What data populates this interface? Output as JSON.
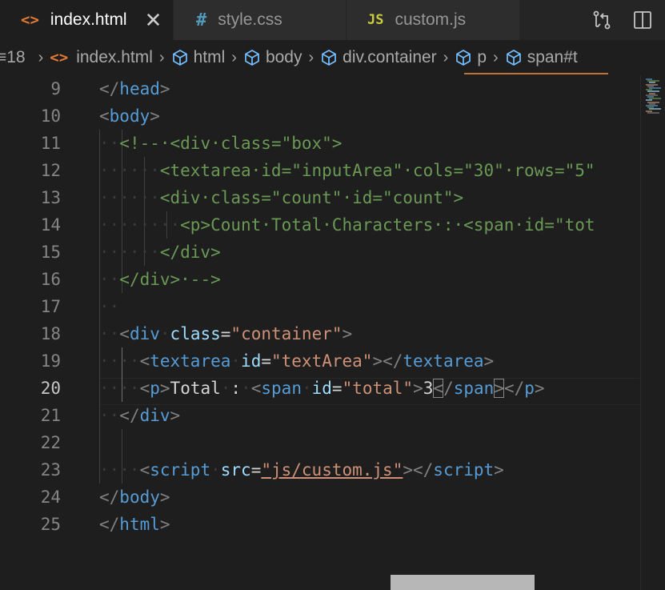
{
  "tabs": [
    {
      "label": "index.html",
      "icon": "<>",
      "active": true,
      "close": "✕"
    },
    {
      "label": "style.css",
      "icon": "#",
      "active": false
    },
    {
      "label": "custom.js",
      "icon": "JS",
      "active": false
    }
  ],
  "breadcrumb": {
    "lead": "≡18",
    "file": "index.html",
    "file_icon": "<>",
    "items": [
      "html",
      "body",
      "div.container",
      "p",
      "span#t"
    ]
  },
  "editor": {
    "active_line": 20,
    "line_numbers": [
      "9",
      "10",
      "11",
      "12",
      "13",
      "14",
      "15",
      "16",
      "17",
      "18",
      "19",
      "20",
      "21",
      "22",
      "23",
      "24",
      "25"
    ],
    "lines": [
      {
        "tokens": [
          {
            "k": "p",
            "v": "</"
          },
          {
            "k": "t",
            "v": "head"
          },
          {
            "k": "p",
            "v": ">"
          }
        ]
      },
      {
        "tokens": [
          {
            "k": "p",
            "v": "<"
          },
          {
            "k": "t",
            "v": "body"
          },
          {
            "k": "p",
            "v": ">"
          }
        ]
      },
      {
        "tokens": [
          {
            "k": "dot",
            "v": "··"
          },
          {
            "k": "c",
            "v": "<!--·<div·class=\"box\">"
          }
        ]
      },
      {
        "tokens": [
          {
            "k": "dot",
            "v": "······"
          },
          {
            "k": "c",
            "v": "<textarea·id=\"inputArea\"·cols=\"30\"·rows=\"5\""
          }
        ]
      },
      {
        "tokens": [
          {
            "k": "dot",
            "v": "······"
          },
          {
            "k": "c",
            "v": "<div·class=\"count\"·id=\"count\">"
          }
        ]
      },
      {
        "tokens": [
          {
            "k": "dot",
            "v": "········"
          },
          {
            "k": "c",
            "v": "<p>Count·Total·Characters·:·<span·id=\"tot"
          }
        ]
      },
      {
        "tokens": [
          {
            "k": "dot",
            "v": "······"
          },
          {
            "k": "c",
            "v": "</div>"
          }
        ]
      },
      {
        "tokens": [
          {
            "k": "dot",
            "v": "··"
          },
          {
            "k": "c",
            "v": "</div>·-->"
          }
        ]
      },
      {
        "tokens": [
          {
            "k": "dot",
            "v": "··"
          }
        ]
      },
      {
        "tokens": [
          {
            "k": "dot",
            "v": "··"
          },
          {
            "k": "p",
            "v": "<"
          },
          {
            "k": "t",
            "v": "div"
          },
          {
            "k": "dot",
            "v": "·"
          },
          {
            "k": "a",
            "v": "class"
          },
          {
            "k": "x",
            "v": "="
          },
          {
            "k": "s",
            "v": "\"container\""
          },
          {
            "k": "p",
            "v": ">"
          }
        ]
      },
      {
        "tokens": [
          {
            "k": "dot",
            "v": "····"
          },
          {
            "k": "p",
            "v": "<"
          },
          {
            "k": "t",
            "v": "textarea"
          },
          {
            "k": "dot",
            "v": "·"
          },
          {
            "k": "a",
            "v": "id"
          },
          {
            "k": "x",
            "v": "="
          },
          {
            "k": "s",
            "v": "\"textArea\""
          },
          {
            "k": "p",
            "v": "></"
          },
          {
            "k": "t",
            "v": "textarea"
          },
          {
            "k": "p",
            "v": ">"
          }
        ]
      },
      {
        "tokens": [
          {
            "k": "dot",
            "v": "····"
          },
          {
            "k": "p",
            "v": "<"
          },
          {
            "k": "t",
            "v": "p"
          },
          {
            "k": "p",
            "v": ">"
          },
          {
            "k": "x",
            "v": "Total"
          },
          {
            "k": "dot",
            "v": "·"
          },
          {
            "k": "x",
            "v": ":"
          },
          {
            "k": "dot",
            "v": "·"
          },
          {
            "k": "p",
            "v": "<"
          },
          {
            "k": "t",
            "v": "span"
          },
          {
            "k": "dot",
            "v": "·"
          },
          {
            "k": "a",
            "v": "id"
          },
          {
            "k": "x",
            "v": "="
          },
          {
            "k": "s",
            "v": "\"total\""
          },
          {
            "k": "p",
            "v": ">"
          },
          {
            "k": "x",
            "v": "3"
          },
          {
            "k": "p bm",
            "v": "<"
          },
          {
            "k": "p",
            "v": "/"
          },
          {
            "k": "t",
            "v": "span"
          },
          {
            "k": "p bm",
            "v": ">"
          },
          {
            "k": "p",
            "v": "</"
          },
          {
            "k": "t",
            "v": "p"
          },
          {
            "k": "p",
            "v": ">"
          }
        ]
      },
      {
        "tokens": [
          {
            "k": "dot",
            "v": "··"
          },
          {
            "k": "p",
            "v": "</"
          },
          {
            "k": "t",
            "v": "div"
          },
          {
            "k": "p",
            "v": ">"
          }
        ]
      },
      {
        "tokens": []
      },
      {
        "tokens": [
          {
            "k": "dot",
            "v": "····"
          },
          {
            "k": "p",
            "v": "<"
          },
          {
            "k": "t",
            "v": "script"
          },
          {
            "k": "dot",
            "v": "·"
          },
          {
            "k": "a",
            "v": "src"
          },
          {
            "k": "x",
            "v": "="
          },
          {
            "k": "s u",
            "v": "\"js/custom.js\""
          },
          {
            "k": "p",
            "v": "></"
          },
          {
            "k": "t",
            "v": "script"
          },
          {
            "k": "p",
            "v": ">"
          }
        ]
      },
      {
        "tokens": [
          {
            "k": "p",
            "v": "</"
          },
          {
            "k": "t",
            "v": "body"
          },
          {
            "k": "p",
            "v": ">"
          }
        ]
      },
      {
        "tokens": [
          {
            "k": "p",
            "v": "</"
          },
          {
            "k": "t",
            "v": "html"
          },
          {
            "k": "p",
            "v": ">"
          }
        ]
      }
    ]
  },
  "colors": {
    "tag": "#569cd6",
    "attribute": "#9cdcfe",
    "string": "#ce9178",
    "comment": "#6a9955",
    "punctuation": "#808080",
    "background": "#1e1e1e"
  }
}
